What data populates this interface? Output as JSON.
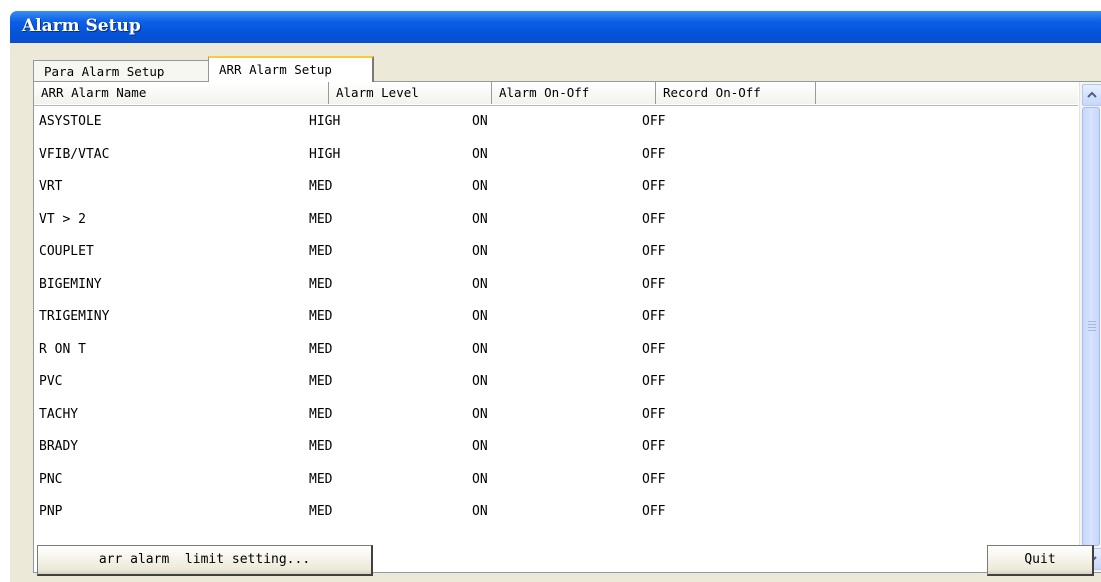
{
  "window": {
    "title": "Alarm Setup"
  },
  "tabs": [
    {
      "label": "Para Alarm Setup",
      "active": false
    },
    {
      "label": "ARR Alarm Setup",
      "active": true
    }
  ],
  "table": {
    "headers": [
      "ARR Alarm Name",
      "Alarm Level",
      "Alarm On-Off",
      "Record On-Off",
      ""
    ],
    "rows": [
      [
        "ASYSTOLE",
        "HIGH",
        "ON",
        "OFF"
      ],
      [
        "VFIB/VTAC",
        "HIGH",
        "ON",
        "OFF"
      ],
      [
        "VRT",
        "MED",
        "ON",
        "OFF"
      ],
      [
        "VT > 2",
        "MED",
        "ON",
        "OFF"
      ],
      [
        "COUPLET",
        "MED",
        "ON",
        "OFF"
      ],
      [
        "BIGEMINY",
        "MED",
        "ON",
        "OFF"
      ],
      [
        "TRIGEMINY",
        "MED",
        "ON",
        "OFF"
      ],
      [
        "R ON T",
        "MED",
        "ON",
        "OFF"
      ],
      [
        "PVC",
        "MED",
        "ON",
        "OFF"
      ],
      [
        "TACHY",
        "MED",
        "ON",
        "OFF"
      ],
      [
        "BRADY",
        "MED",
        "ON",
        "OFF"
      ],
      [
        "PNC",
        "MED",
        "ON",
        "OFF"
      ],
      [
        "PNP",
        "MED",
        "ON",
        "OFF"
      ]
    ]
  },
  "scrollbar": {
    "up_icon": "chevron-up-icon",
    "down_icon": "chevron-down-icon"
  },
  "buttons": {
    "arr_limit_label": "arr alarm  limit setting...",
    "quit_label": "Quit"
  },
  "colors": {
    "titlebar": "#0553d9",
    "client_bg": "#ece9d8",
    "active_tab_accent": "#ffc83c"
  }
}
